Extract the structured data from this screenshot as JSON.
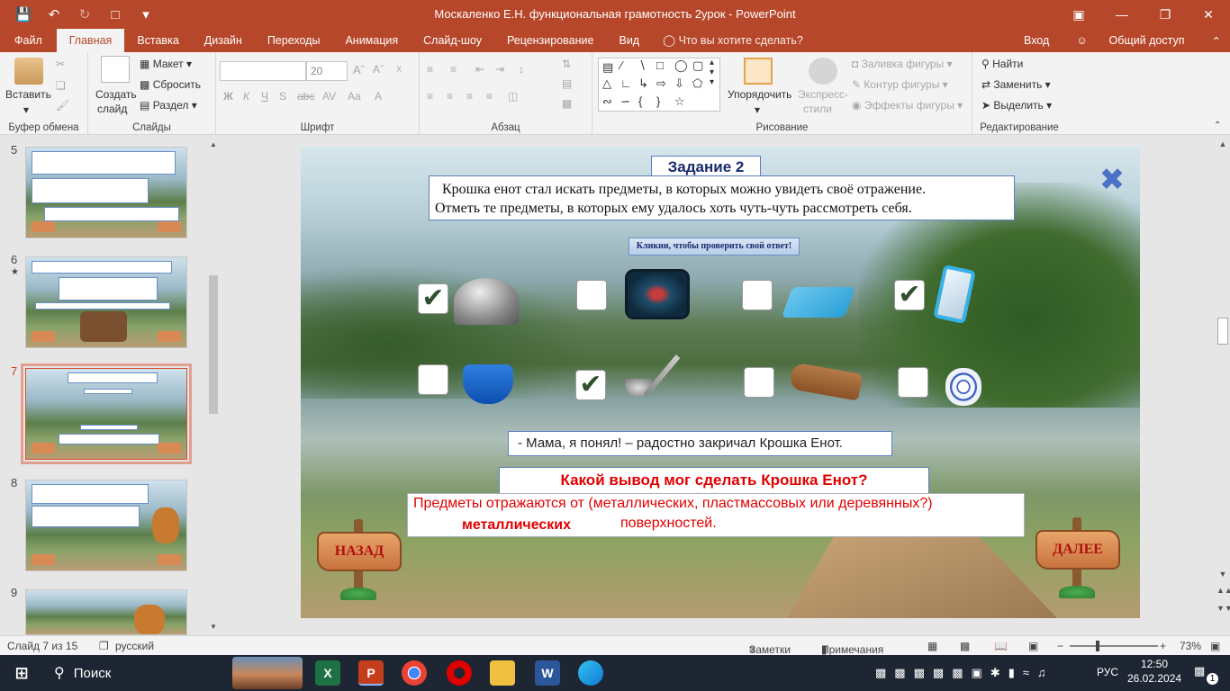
{
  "window": {
    "title": "Москаленко Е.Н. функциональная грамотность 2урок  -  PowerPoint"
  },
  "tabs": [
    "Файл",
    "Главная",
    "Вставка",
    "Дизайн",
    "Переходы",
    "Анимация",
    "Слайд-шоу",
    "Рецензирование",
    "Вид"
  ],
  "tell_me": "Что вы хотите сделать?",
  "signin": "Вход",
  "share": "Общий доступ",
  "ribbon": {
    "clipboard": {
      "label": "Буфер обмена",
      "paste": "Вставить"
    },
    "slides": {
      "label": "Слайды",
      "new_slide_1": "Создать",
      "new_slide_2": "слайд",
      "layout": "Макет",
      "reset": "Сбросить",
      "section": "Раздел"
    },
    "font": {
      "label": "Шрифт",
      "size": "20"
    },
    "paragraph": {
      "label": "Абзац"
    },
    "drawing": {
      "label": "Рисование",
      "arrange": "Упорядочить",
      "quick_styles_1": "Экспресс-",
      "quick_styles_2": "стили",
      "fill": "Заливка фигуры",
      "outline": "Контур фигуры",
      "effects": "Эффекты фигуры"
    },
    "editing": {
      "label": "Редактирование",
      "find": "Найти",
      "replace": "Заменить",
      "select": "Выделить"
    }
  },
  "thumbnails": [
    {
      "num": "5"
    },
    {
      "num": "6",
      "star": "★"
    },
    {
      "num": "7"
    },
    {
      "num": "8"
    },
    {
      "num": "9"
    }
  ],
  "slide": {
    "task_title": "Задание 2",
    "instruction_1": "  Крошка енот стал искать предметы, в которых можно увидеть своё отражение.",
    "instruction_2": "Отметь те предметы, в которых ему удалось хоть чуть-чуть рассмотреть себя.",
    "check_button": "Кликни, чтобы проверить свой ответ!",
    "items": [
      {
        "name": "cloche",
        "checked": true,
        "mark": "✔"
      },
      {
        "name": "tray",
        "checked": false,
        "mark": ""
      },
      {
        "name": "cloth",
        "checked": false,
        "mark": ""
      },
      {
        "name": "mirror",
        "checked": true,
        "mark": "✔"
      },
      {
        "name": "basin",
        "checked": false,
        "mark": ""
      },
      {
        "name": "ladle",
        "checked": true,
        "mark": "✔"
      },
      {
        "name": "board",
        "checked": false,
        "mark": ""
      },
      {
        "name": "vase",
        "checked": false,
        "mark": ""
      }
    ],
    "speech": "- Мама, я понял! – радостно закричал Крошка Енот.",
    "question": "Какой вывод мог сделать Крошка Енот?",
    "conclusion_1": "Предметы отражаются от (металлических, пластмассовых или деревянных?)",
    "conclusion_2": "поверхностей.",
    "answer": "металлических",
    "back": "НАЗАД",
    "next": "ДАЛЕЕ"
  },
  "status": {
    "slide_info": "Слайд 7 из 15",
    "language": "русский",
    "notes": "Заметки",
    "comments": "Примечания",
    "zoom": "73%"
  },
  "taskbar": {
    "search": "Поиск",
    "lang": "РУС",
    "time": "12:50",
    "date": "26.02.2024",
    "notif": "1"
  },
  "colors": {
    "accent": "#b7472a",
    "answer": "#e00000"
  }
}
